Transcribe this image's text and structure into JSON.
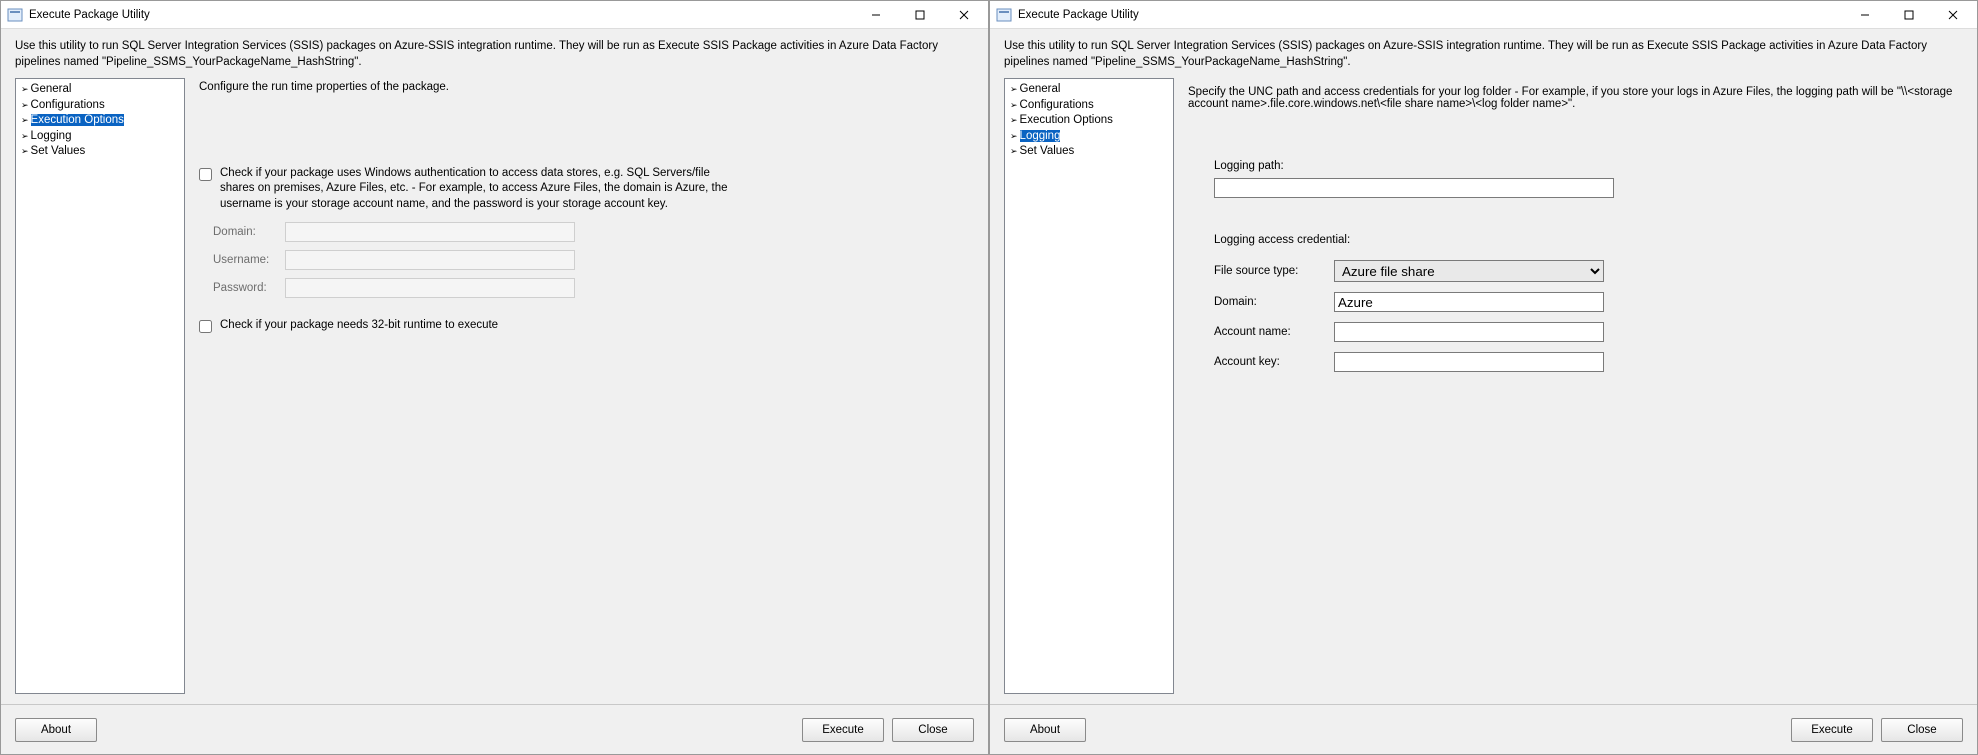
{
  "left": {
    "title": "Execute Package Utility",
    "description": "Use this utility to run SQL Server Integration Services (SSIS) packages on Azure-SSIS integration runtime. They will be run as Execute SSIS Package activities in Azure Data Factory pipelines named \"Pipeline_SSMS_YourPackageName_HashString\".",
    "nav": {
      "items": [
        "General",
        "Configurations",
        "Execution Options",
        "Logging",
        "Set Values"
      ],
      "selected_index": 2
    },
    "main_heading": "Configure the run time properties of the package.",
    "auth_check_label": "Check if your package uses Windows authentication to access data stores, e.g. SQL Servers/file shares on premises, Azure Files, etc. - For example, to access Azure Files, the domain is Azure, the username is your storage account name, and the password is your storage account key.",
    "fields": {
      "domain_label": "Domain:",
      "domain_value": "",
      "username_label": "Username:",
      "username_value": "",
      "password_label": "Password:",
      "password_value": ""
    },
    "bit32_label": "Check if your package needs 32-bit runtime to execute",
    "footer": {
      "about": "About",
      "execute": "Execute",
      "close": "Close"
    }
  },
  "right": {
    "title": "Execute Package Utility",
    "description": "Use this utility to run SQL Server Integration Services (SSIS) packages on Azure-SSIS integration runtime. They will be run as Execute SSIS Package activities in Azure Data Factory pipelines named \"Pipeline_SSMS_YourPackageName_HashString\".",
    "nav": {
      "items": [
        "General",
        "Configurations",
        "Execution Options",
        "Logging",
        "Set Values"
      ],
      "selected_index": 3
    },
    "main_heading": "Specify the UNC path and access credentials for your log folder - For example, if you store your logs in Azure Files, the logging path will be \"\\\\<storage account name>.file.core.windows.net\\<file share name>\\<log folder name>\".",
    "logging_path_label": "Logging path:",
    "logging_path_value": "",
    "credential_section": "Logging access credential:",
    "fields": {
      "file_source_label": "File source type:",
      "file_source_value": "Azure file share",
      "domain_label": "Domain:",
      "domain_value": "Azure",
      "account_name_label": "Account name:",
      "account_name_value": "",
      "account_key_label": "Account key:",
      "account_key_value": ""
    },
    "footer": {
      "about": "About",
      "execute": "Execute",
      "close": "Close"
    }
  }
}
